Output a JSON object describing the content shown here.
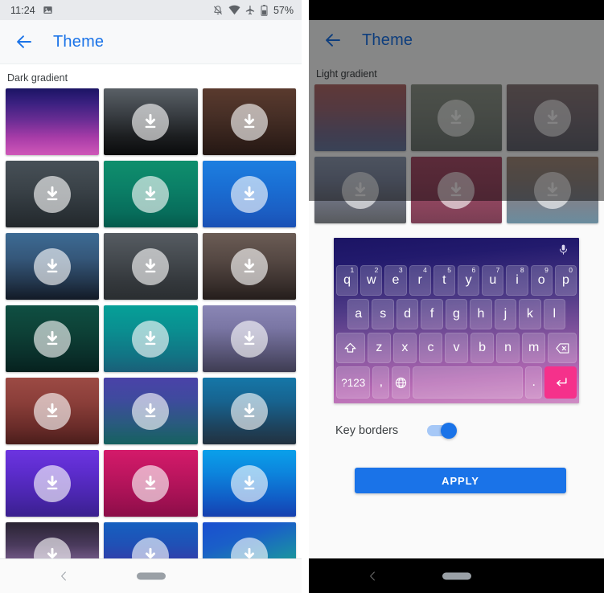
{
  "left_panel": {
    "status_bar": {
      "time": "11:24",
      "icons": [
        "image-icon",
        "notifications-off-icon",
        "wifi-icon",
        "airplane-mode-icon",
        "battery-icon"
      ],
      "battery_text": "57%"
    },
    "app_bar": {
      "title": "Theme",
      "back_icon": "back-arrow-icon"
    },
    "section_label": "Dark gradient",
    "themes": [
      {
        "name": "dark-navy-magenta",
        "gradient": "linear-gradient(180deg, #1b1464 0%, #3a2080 22%, #6b2d94 48%, #a83ca8 74%, #cf58b8 100%)",
        "downloadable": false
      },
      {
        "name": "charcoal-black",
        "gradient": "linear-gradient(180deg, #5a6066 0%, #3a3f44 38%, #1c1e20 72%, #0a0b0c 100%)",
        "downloadable": true
      },
      {
        "name": "dark-brown",
        "gradient": "linear-gradient(180deg, #5a3a2e 0%, #472f26 40%, #33211b 75%, #241713 100%)",
        "downloadable": true
      },
      {
        "name": "slate-gray",
        "gradient": "linear-gradient(180deg, #475057 0%, #3b4349 40%, #2c3338 75%, #23282c 100%)",
        "downloadable": true
      },
      {
        "name": "emerald-teal",
        "gradient": "linear-gradient(180deg, #0f8f6d 0%, #0b8067 40%, #076d5b 78%, #055a4c 100%)",
        "downloadable": true
      },
      {
        "name": "bright-blue",
        "gradient": "linear-gradient(180deg, #1d7fe0 0%, #1a6fd4 38%, #1b5fc4 75%, #1a50b5 100%)",
        "downloadable": true
      },
      {
        "name": "steel-blue-night",
        "gradient": "linear-gradient(180deg, #3d6b94 0%, #35577a 38%, #24384f 72%, #121a26 100%)",
        "downloadable": true
      },
      {
        "name": "graphite",
        "gradient": "linear-gradient(180deg, #565c62 0%, #44494e 40%, #33373b 75%, #2a2e31 100%)",
        "downloadable": true
      },
      {
        "name": "warm-taupe-dark",
        "gradient": "linear-gradient(180deg, #6b5c55 0%, #554843 40%, #3a302d 76%, #241d1b 100%)",
        "downloadable": true
      },
      {
        "name": "deep-forest",
        "gradient": "linear-gradient(180deg, #0f4f42 0%, #0d4036 42%, #0a2f2a 76%, #06211e 100%)",
        "downloadable": true
      },
      {
        "name": "teal-ocean",
        "gradient": "linear-gradient(180deg, #06a098 0%, #0a8e90 38%, #117585 74%, #1a5f78 100%)",
        "downloadable": true
      },
      {
        "name": "lavender-slate",
        "gradient": "linear-gradient(180deg, #8a86b5 0%, #7a76a4 34%, #5d5a7d 66%, #3e3c52 100%)",
        "downloadable": true
      },
      {
        "name": "brick-red",
        "gradient": "linear-gradient(180deg, #9c4a44 0%, #8a3e39 38%, #6a2c29 74%, #4a1d1b 100%)",
        "downloadable": true
      },
      {
        "name": "indigo-teal",
        "gradient": "linear-gradient(180deg, #4a42a8 0%, #3f4a9e 32%, #2a5a7f 68%, #15615f 100%)",
        "downloadable": true
      },
      {
        "name": "deep-azure",
        "gradient": "linear-gradient(180deg, #1577a8 0%, #17638f 36%, #1d4560 72%, #22313f 100%)",
        "downloadable": true
      },
      {
        "name": "violet-purple",
        "gradient": "linear-gradient(180deg, #6c34e0 0%, #5c2ccc 34%, #4a26ad 70%, #3a1f8e 100%)",
        "downloadable": true
      },
      {
        "name": "crimson-magenta",
        "gradient": "linear-gradient(180deg, #d41a6a 0%, #bf1660 34%, #a51154 70%, #8c0d48 100%)",
        "downloadable": true
      },
      {
        "name": "sky-blue-deep",
        "gradient": "linear-gradient(180deg, #0aa0ea 0%, #0c85dd 34%, #1060c8 70%, #1640b0 100%)",
        "downloadable": true
      },
      {
        "name": "dark-plum-rose",
        "gradient": "linear-gradient(180deg, #2a2433 0%, #4a3a5c 34%, #8a6a9e 70%, #c79aa6 100%)",
        "downloadable": true
      },
      {
        "name": "blue-indigo",
        "gradient": "linear-gradient(180deg, #1560c0 0%, #2050b5 34%, #3a35a5 70%, #4a2a98 100%)",
        "downloadable": true
      },
      {
        "name": "blue-green-radial",
        "gradient": "linear-gradient(160deg, #1a4fd0 0%, #1a5fc8 30%, #1a8aa8 62%, #19a878 88%, #18b06a 100%)",
        "downloadable": true
      }
    ],
    "nav_bar": {
      "back_icon": "nav-back-icon",
      "home_icon": "nav-home-pill"
    }
  },
  "right_panel": {
    "app_bar": {
      "title": "Theme",
      "back_icon": "back-arrow-icon"
    },
    "section_label": "Light gradient",
    "themes": [
      {
        "name": "rose-slate",
        "gradient": "linear-gradient(180deg, #b06a68 0%, #9a6a78 38%, #7a7090 72%, #6a7aa0 100%)",
        "downloadable": false
      },
      {
        "name": "sage-gray",
        "gradient": "linear-gradient(180deg, #8e958a 0%, #848b82 40%, #78807a 75%, #6e7672 100%)",
        "downloadable": true
      },
      {
        "name": "mauve-gray",
        "gradient": "linear-gradient(180deg, #8a7a7a 0%, #7e7278 38%, #6e6a74 74%, #62646e 100%)",
        "downloadable": true
      },
      {
        "name": "blue-gray-fade",
        "gradient": "linear-gradient(180deg, #8e9ab0 0%, #7e88a0 34%, #6a6e7a 70%, #585a5e 100%)",
        "downloadable": true
      },
      {
        "name": "wine-rose",
        "gradient": "linear-gradient(180deg, #a8506a 0%, #9a4a64 38%, #8a445c 74%, #7a3e54 100%)",
        "downloadable": true
      },
      {
        "name": "tan-teal",
        "gradient": "linear-gradient(180deg, #a08878 0%, #8e8480 38%, #7a8490 74%, #6a8c9e 100%)",
        "downloadable": true
      }
    ],
    "keyboard_preview": {
      "mic_icon": "microphone-icon",
      "row1": [
        {
          "key": "q",
          "num": "1"
        },
        {
          "key": "w",
          "num": "2"
        },
        {
          "key": "e",
          "num": "3"
        },
        {
          "key": "r",
          "num": "4"
        },
        {
          "key": "t",
          "num": "5"
        },
        {
          "key": "y",
          "num": "6"
        },
        {
          "key": "u",
          "num": "7"
        },
        {
          "key": "i",
          "num": "8"
        },
        {
          "key": "o",
          "num": "9"
        },
        {
          "key": "p",
          "num": "0"
        }
      ],
      "row2": [
        "a",
        "s",
        "d",
        "f",
        "g",
        "h",
        "j",
        "k",
        "l"
      ],
      "row3": [
        {
          "key": "shift",
          "icon": "shift-icon",
          "label": ""
        },
        {
          "key": "z",
          "label": "z"
        },
        {
          "key": "x",
          "label": "x"
        },
        {
          "key": "c",
          "label": "c"
        },
        {
          "key": "v",
          "label": "v"
        },
        {
          "key": "b",
          "label": "b"
        },
        {
          "key": "n",
          "label": "n"
        },
        {
          "key": "m",
          "label": "m"
        },
        {
          "key": "backspace",
          "icon": "backspace-icon",
          "label": ""
        }
      ],
      "row4": [
        {
          "key": "symbols",
          "label": "?123"
        },
        {
          "key": "comma",
          "label": ","
        },
        {
          "key": "language",
          "icon": "globe-icon",
          "label": ""
        },
        {
          "key": "space",
          "label": ""
        },
        {
          "key": "period",
          "label": "."
        },
        {
          "key": "enter",
          "icon": "enter-icon",
          "label": ""
        }
      ],
      "enter_key_color": "#f5318b"
    },
    "key_borders": {
      "label": "Key borders",
      "enabled": true,
      "accent": "#1a73e8"
    },
    "apply_button": {
      "label": "APPLY",
      "color": "#1a73e8"
    },
    "nav_bar": {
      "back_icon": "nav-back-icon",
      "home_icon": "nav-home-pill"
    }
  }
}
